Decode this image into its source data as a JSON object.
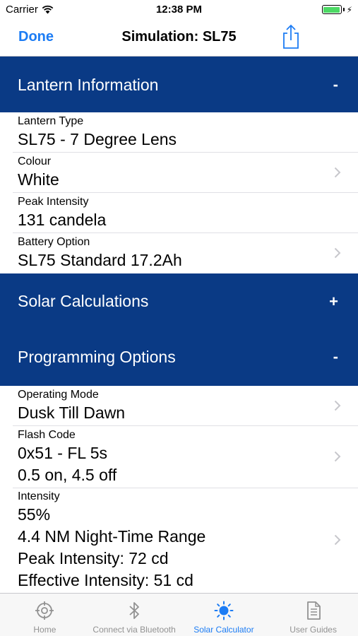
{
  "status": {
    "carrier": "Carrier",
    "time": "12:38 PM"
  },
  "nav": {
    "done_label": "Done",
    "title": "Simulation: SL75"
  },
  "sections": {
    "lantern": {
      "title": "Lantern Information",
      "toggle": "-",
      "rows": [
        {
          "label": "Lantern Type",
          "value": "SL75 - 7 Degree Lens"
        },
        {
          "label": "Colour",
          "value": "White"
        },
        {
          "label": "Peak Intensity",
          "value": "131 candela"
        },
        {
          "label": "Battery Option",
          "value": "SL75 Standard 17.2Ah"
        }
      ]
    },
    "solar": {
      "title": "Solar Calculations",
      "toggle": "+"
    },
    "programming": {
      "title": "Programming Options",
      "toggle": "-",
      "rows": [
        {
          "label": "Operating Mode",
          "value": "Dusk Till Dawn"
        },
        {
          "label": "Flash Code",
          "lines": [
            "0x51 - FL 5s",
            "0.5 on, 4.5 off"
          ]
        },
        {
          "label": "Intensity",
          "lines": [
            "55%",
            "4.4 NM Night-Time Range",
            "Peak Intensity: 72 cd",
            "Effective Intensity: 51 cd"
          ]
        }
      ]
    }
  },
  "tabs": [
    {
      "label": "Home",
      "icon": "compass-icon"
    },
    {
      "label": "Connect via Bluetooth",
      "icon": "bluetooth-icon"
    },
    {
      "label": "Solar Calculator",
      "icon": "sun-icon",
      "active": true
    },
    {
      "label": "User Guides",
      "icon": "document-icon"
    }
  ],
  "colors": {
    "accent": "#1c7cf4",
    "section_header": "#0a3a85",
    "battery": "#4cd964"
  }
}
